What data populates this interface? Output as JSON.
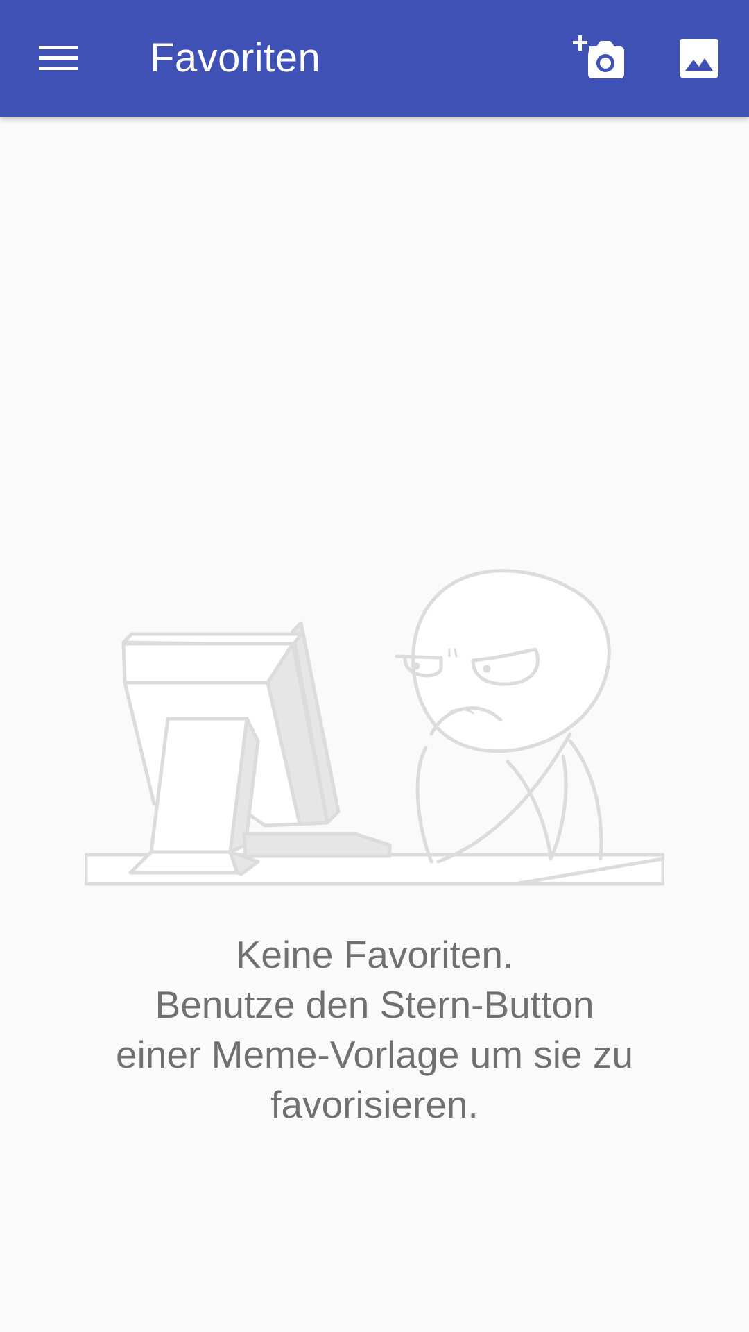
{
  "appbar": {
    "title": "Favoriten",
    "color": "#3f51b5",
    "menu_icon": "hamburger-menu-icon",
    "actions": [
      {
        "icon": "add-photo-camera-icon"
      },
      {
        "icon": "image-gallery-icon"
      }
    ]
  },
  "empty_state": {
    "illustration": "meme-guy-at-computer",
    "line1": "Keine Favoriten.",
    "line2": "Benutze den Stern-Button",
    "line3": "einer Meme-Vorlage um sie zu",
    "line4": "favorisieren."
  }
}
